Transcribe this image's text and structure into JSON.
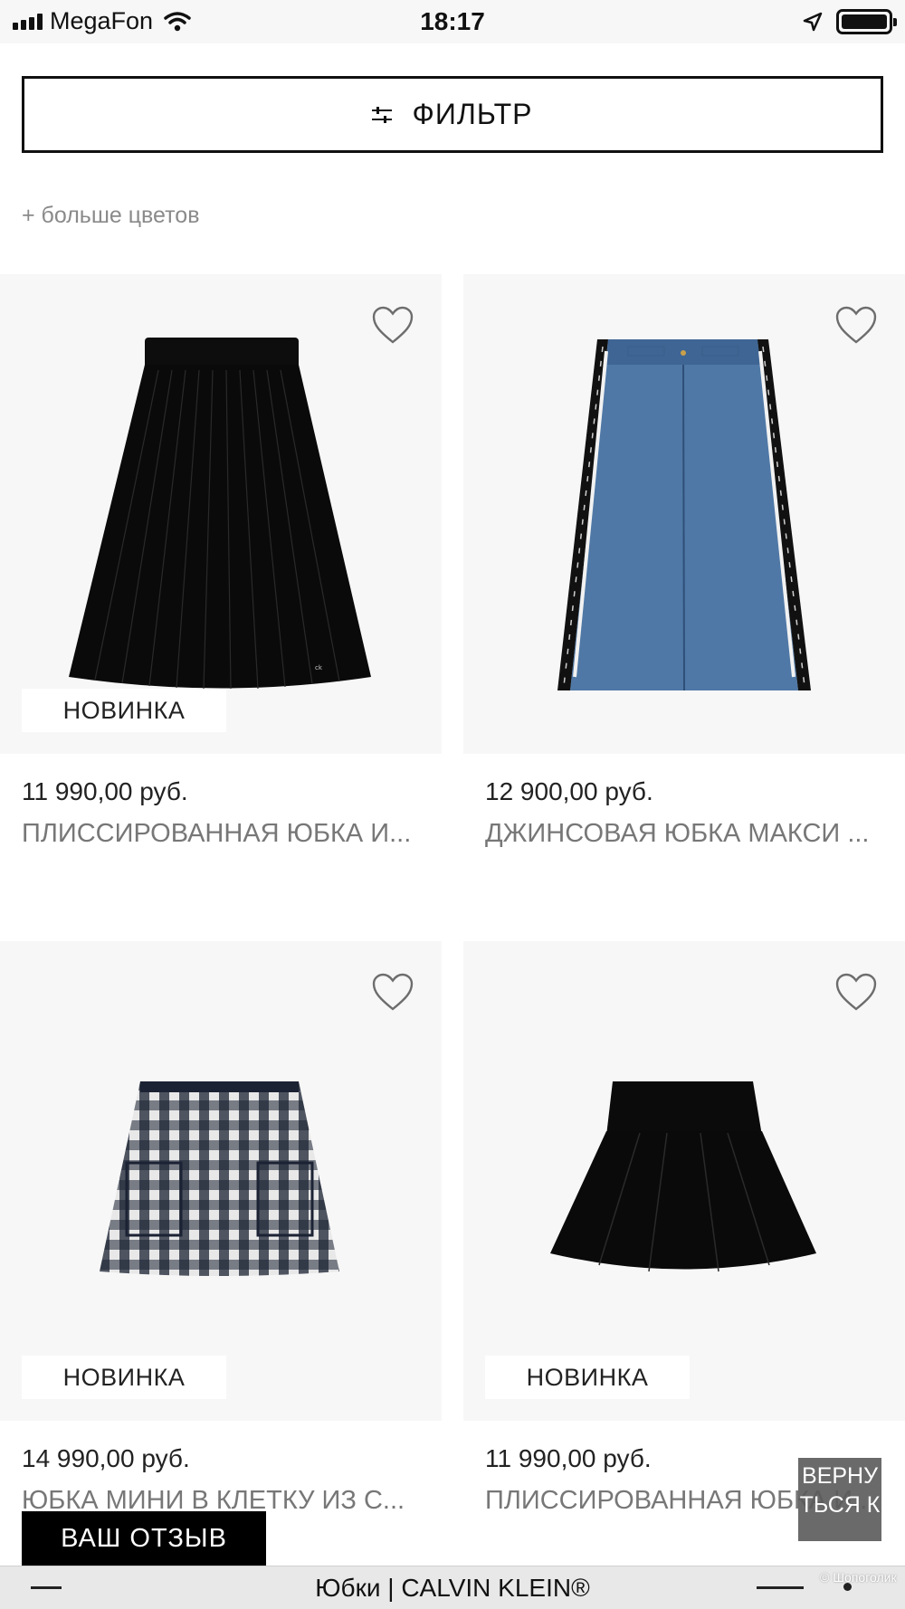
{
  "status_bar": {
    "carrier": "MegaFon",
    "time": "18:17"
  },
  "filter": {
    "label": "ФИЛЬТР",
    "icon": "sliders-icon"
  },
  "more_colors": "+ больше цветов",
  "products": [
    {
      "price": "11 990,00 руб.",
      "name": "ПЛИССИРОВАННАЯ ЮБКА И...",
      "badge": "НОВИНКА",
      "image": "black-pleated-midi-skirt"
    },
    {
      "price": "12 900,00 руб.",
      "name": "ДЖИНСОВАЯ ЮБКА МАКСИ ...",
      "badge": "",
      "image": "denim-maxi-skirt"
    },
    {
      "price": "14 990,00 руб.",
      "name": "ЮБКА МИНИ В КЛЕТКУ ИЗ С...",
      "badge": "НОВИНКА",
      "image": "plaid-mini-skirt"
    },
    {
      "price": "11 990,00 руб.",
      "name": "ПЛИССИРОВАННАЯ ЮБКА И...",
      "badge": "НОВИНКА",
      "image": "black-pleated-mini-skirt"
    }
  ],
  "review_button": "ВАШ ОТЗЫВ",
  "back_to_top": "ВЕРНУТЬСЯ К",
  "bottom_bar": {
    "title": "Юбки | CALVIN KLEIN®"
  },
  "watermark": "© Шопоголик",
  "colors": {
    "card_bg": "#f7f7f7",
    "denim": "#4f78a6",
    "grey_text": "#777777"
  }
}
